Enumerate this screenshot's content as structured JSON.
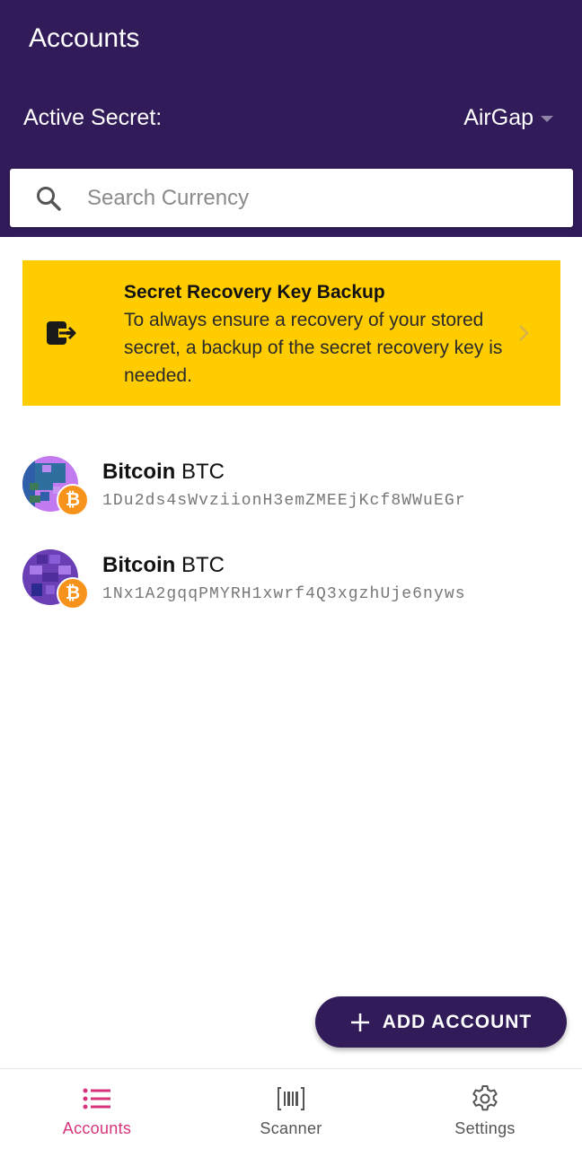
{
  "header": {
    "title": "Accounts",
    "active_secret_label": "Active Secret:",
    "active_secret_value": "AirGap",
    "background_color": "#311b58"
  },
  "search": {
    "placeholder": "Search Currency",
    "value": "",
    "icon": "search-icon"
  },
  "banner": {
    "title": "Secret Recovery Key Backup",
    "body": "To always ensure a recovery of your stored secret, a backup of the secret recovery key is needed.",
    "icon": "exit-icon",
    "background_color": "#ffcc00"
  },
  "accounts": [
    {
      "name": "Bitcoin",
      "symbol": "BTC",
      "address": "1Du2ds4sWvziionH3emZMEEjKcf8WWuEGr",
      "badge_icon": "bitcoin-icon"
    },
    {
      "name": "Bitcoin",
      "symbol": "BTC",
      "address": "1Nx1A2gqqPMYRH1xwrf4Q3xgzhUje6nyws",
      "badge_icon": "bitcoin-icon"
    }
  ],
  "fab": {
    "label": "ADD ACCOUNT",
    "icon": "plus-icon"
  },
  "tabs": [
    {
      "label": "Accounts",
      "icon": "list-icon",
      "active": true
    },
    {
      "label": "Scanner",
      "icon": "barcode-icon",
      "active": false
    },
    {
      "label": "Settings",
      "icon": "gear-icon",
      "active": false
    }
  ],
  "colors": {
    "accent": "#d8347a",
    "bitcoin": "#f7931a"
  }
}
